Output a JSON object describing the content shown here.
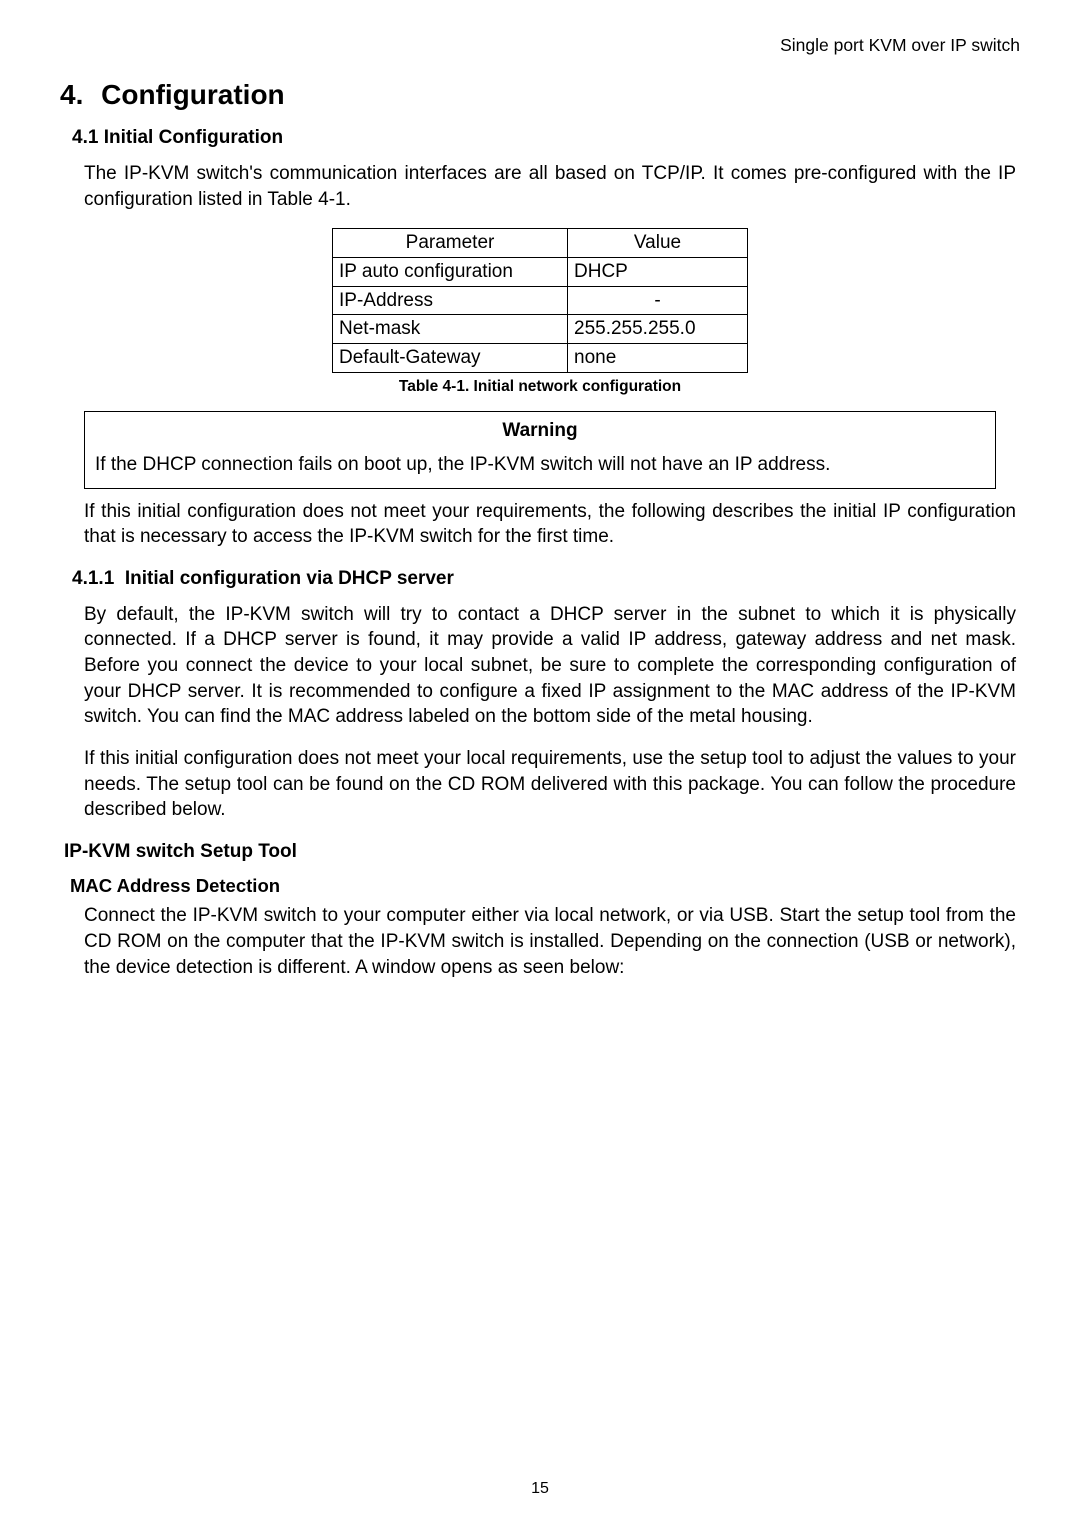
{
  "header": {
    "right": "Single port KVM over IP switch"
  },
  "section": {
    "number": "4.",
    "title": "Configuration"
  },
  "sub1": {
    "number": "4.1",
    "title": "Initial Configuration"
  },
  "intro": "The IP-KVM switch's communication interfaces are all based on TCP/IP. It comes pre-configured with the IP configuration listed in Table 4-1.",
  "table": {
    "head": {
      "param": "Parameter",
      "value": "Value"
    },
    "rows": [
      {
        "param": "IP auto configuration",
        "value": "DHCP"
      },
      {
        "param": "IP-Address",
        "value": "-"
      },
      {
        "param": "Net-mask",
        "value": "255.255.255.0"
      },
      {
        "param": "Default-Gateway",
        "value": "none"
      }
    ],
    "caption": "Table 4-1. Initial network configuration"
  },
  "warning": {
    "title": "Warning",
    "text": "If the DHCP connection fails on boot up, the IP-KVM switch will not have an IP address."
  },
  "after_warning": "If this initial configuration does not meet your requirements, the following describes the initial IP configuration that is necessary to access the IP-KVM switch for the first time.",
  "sub2": {
    "number": "4.1.1",
    "title": "Initial configuration via DHCP server"
  },
  "dhcp_p1": "By default, the IP-KVM switch will try to contact a DHCP server in the subnet to which it is physically connected. If a DHCP server is found, it may provide a valid IP address, gateway address and net mask. Before you connect the device to your local subnet, be sure to complete the corresponding configuration of your DHCP server. It is recommended to configure a fixed IP assignment to the MAC address of the IP-KVM switch. You can find the MAC address labeled on the bottom side of the metal housing.",
  "dhcp_p2": "If this initial configuration does not meet your local requirements, use the setup tool to adjust the values to your needs. The setup tool can be found on the CD ROM delivered with this package. You can follow the procedure described below.",
  "tool": {
    "title": "IP-KVM switch Setup Tool"
  },
  "mac": {
    "title": "MAC Address Detection",
    "text": "Connect the IP-KVM switch to your computer either via local network, or via USB. Start the setup tool from the CD ROM on the computer that the IP-KVM switch is installed. Depending on the connection (USB or network), the device detection is different. A window opens as seen below:"
  },
  "page_number": "15",
  "chart_data": {
    "type": "table",
    "title": "Table 4-1. Initial network configuration",
    "columns": [
      "Parameter",
      "Value"
    ],
    "rows": [
      [
        "IP auto configuration",
        "DHCP"
      ],
      [
        "IP-Address",
        "-"
      ],
      [
        "Net-mask",
        "255.255.255.0"
      ],
      [
        "Default-Gateway",
        "none"
      ]
    ]
  }
}
